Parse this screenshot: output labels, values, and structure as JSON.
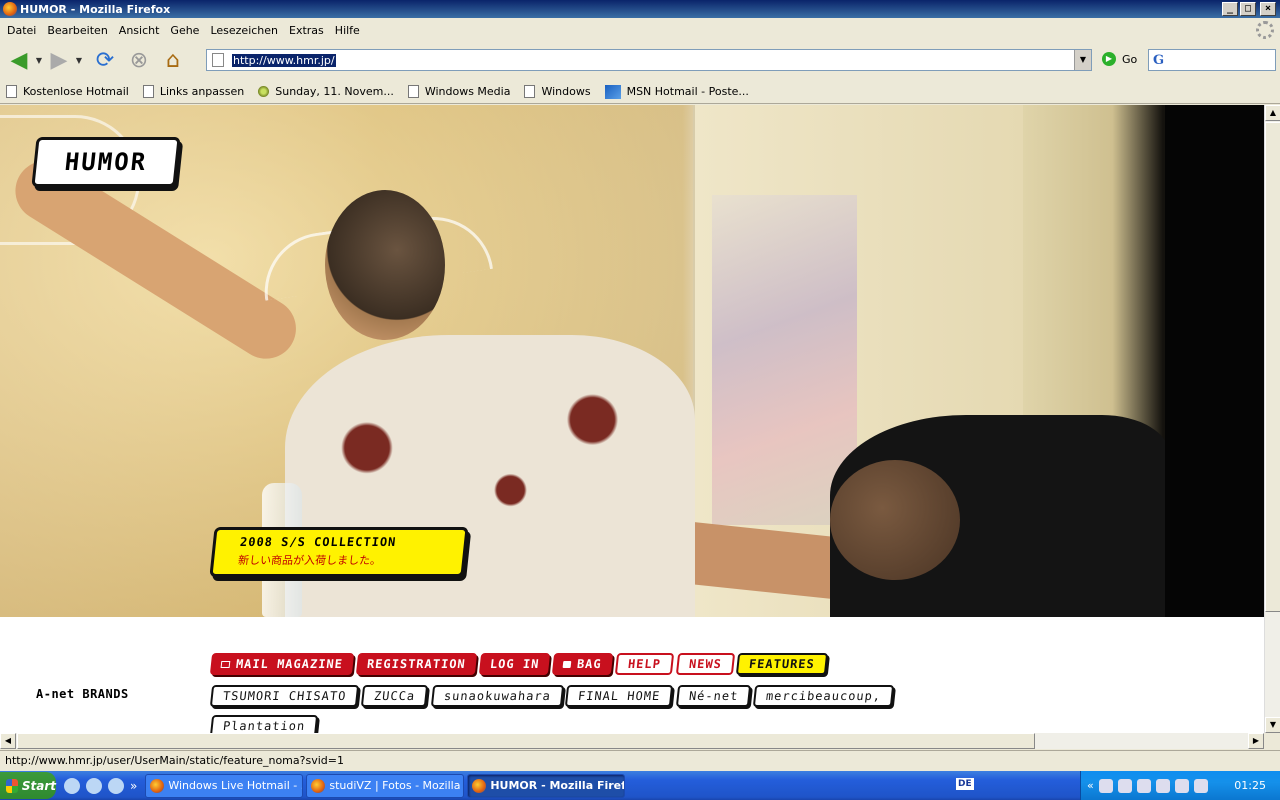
{
  "window": {
    "title": "HUMOR - Mozilla Firefox"
  },
  "menu": [
    "Datei",
    "Bearbeiten",
    "Ansicht",
    "Gehe",
    "Lesezeichen",
    "Extras",
    "Hilfe"
  ],
  "navbar": {
    "url": "http://www.hmr.jp/",
    "go_label": "Go"
  },
  "bookmarks": [
    {
      "label": "Kostenlose Hotmail",
      "icon": "page-icon"
    },
    {
      "label": "Links anpassen",
      "icon": "page-icon"
    },
    {
      "label": "Sunday, 11. Novem...",
      "icon": "live-bookmark-icon"
    },
    {
      "label": "Windows Media",
      "icon": "page-icon"
    },
    {
      "label": "Windows",
      "icon": "page-icon"
    },
    {
      "label": "MSN Hotmail - Poste...",
      "icon": "msn-icon"
    }
  ],
  "page": {
    "logo": "HUMOR",
    "collection": {
      "title": "2008 S/S COLLECTION",
      "subtitle": "新しい商品が入荷しました。"
    },
    "nav": {
      "mail_magazine": "MAIL MAGAZINE",
      "registration": "REGISTRATION",
      "login": "LOG IN",
      "bag": "BAG",
      "help": "HELP",
      "news": "NEWS",
      "features": "FEATURES"
    },
    "brands_label": "A-net BRANDS",
    "brands": [
      "TSUMORI CHISATO",
      "ZUCCa",
      "sunaokuwahara",
      "FINAL HOME",
      "Né-net",
      "mercibeaucoup,",
      "Plantation"
    ]
  },
  "status": {
    "text": "http://www.hmr.jp/user/UserMain/static/feature_noma?svid=1"
  },
  "taskbar": {
    "start": "Start",
    "tasks": [
      "Windows Live Hotmail - ...",
      "studiVZ | Fotos - Mozilla ...",
      "HUMOR - Mozilla Firef..."
    ],
    "lang": "DE",
    "clock": "01:25"
  }
}
